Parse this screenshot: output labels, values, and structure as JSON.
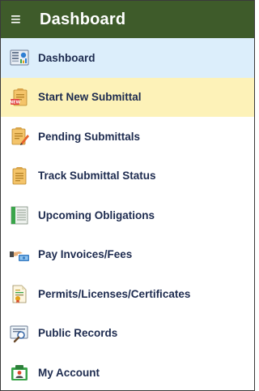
{
  "header": {
    "menu_icon": "hamburger-icon",
    "menu_glyph": "≡",
    "title": "Dashboard",
    "color": "#3e5b2a"
  },
  "menu": {
    "items": [
      {
        "label": "Dashboard",
        "icon": "dashboard-icon",
        "state": "active"
      },
      {
        "label": "Start New Submittal",
        "icon": "new-submittal-icon",
        "state": "highlighted"
      },
      {
        "label": "Pending Submittals",
        "icon": "pending-submittals-icon",
        "state": "normal"
      },
      {
        "label": "Track Submittal Status",
        "icon": "track-status-icon",
        "state": "normal"
      },
      {
        "label": "Upcoming Obligations",
        "icon": "upcoming-obligations-icon",
        "state": "normal"
      },
      {
        "label": "Pay Invoices/Fees",
        "icon": "pay-invoices-icon",
        "state": "normal"
      },
      {
        "label": "Permits/Licenses/Certificates",
        "icon": "permits-certificate-icon",
        "state": "normal"
      },
      {
        "label": "Public Records",
        "icon": "public-records-icon",
        "state": "normal"
      },
      {
        "label": "My Account",
        "icon": "my-account-icon",
        "state": "normal"
      }
    ]
  },
  "colors": {
    "active_bg": "#dceefb",
    "highlight_bg": "#fdf2b8",
    "label_text": "#1d2b4f"
  }
}
